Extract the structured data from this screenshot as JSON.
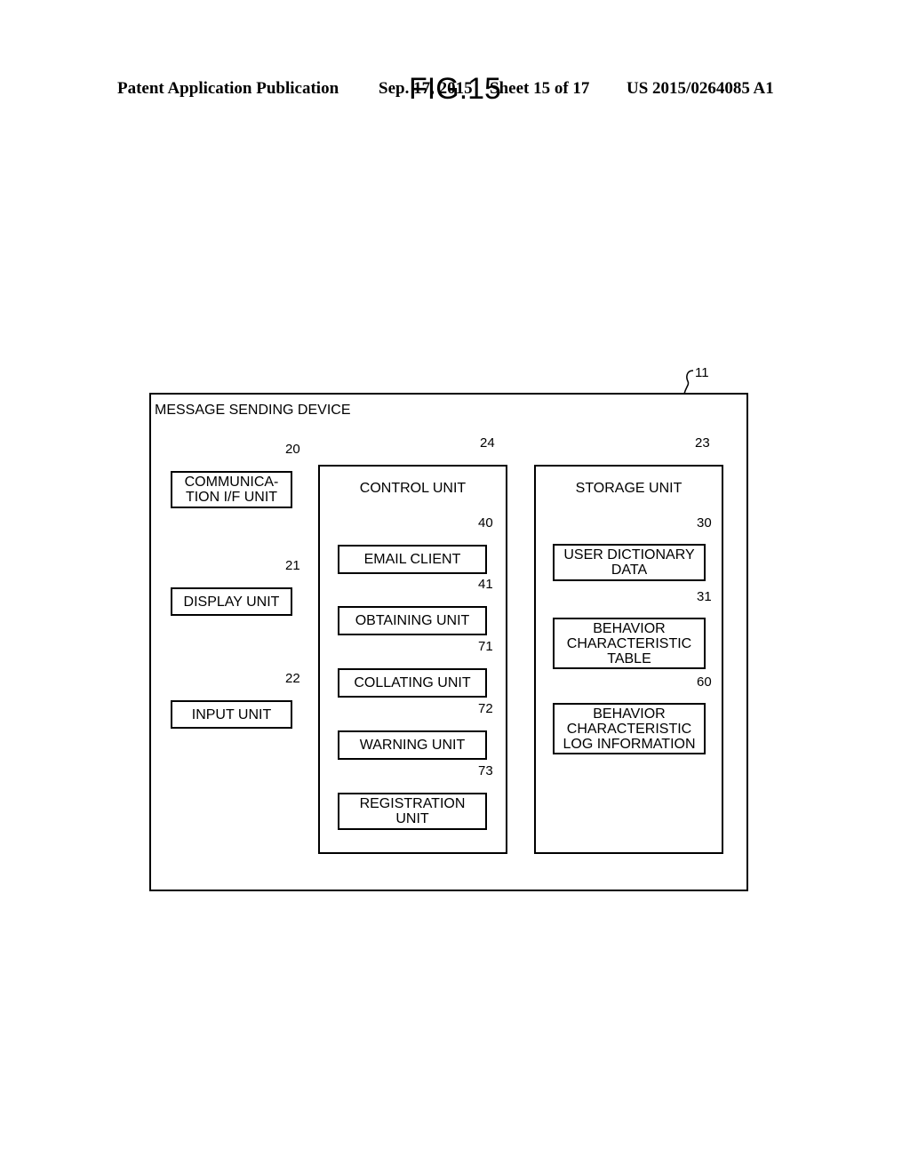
{
  "header": {
    "publication": "Patent Application Publication",
    "date": "Sep. 17, 2015",
    "sheet": "Sheet 15 of 17",
    "number": "US 2015/0264085 A1"
  },
  "figure": {
    "title": "FIG.15",
    "device": {
      "ref": "11",
      "label": "MESSAGE SENDING DEVICE"
    },
    "left_units": [
      {
        "ref": "20",
        "label": "COMMUNICA-\nTION I/F UNIT"
      },
      {
        "ref": "21",
        "label": "DISPLAY UNIT"
      },
      {
        "ref": "22",
        "label": "INPUT UNIT"
      }
    ],
    "control": {
      "ref": "24",
      "label": "CONTROL UNIT",
      "units": [
        {
          "ref": "40",
          "label": "EMAIL CLIENT"
        },
        {
          "ref": "41",
          "label": "OBTAINING UNIT"
        },
        {
          "ref": "71",
          "label": "COLLATING UNIT"
        },
        {
          "ref": "72",
          "label": "WARNING UNIT"
        },
        {
          "ref": "73",
          "label": "REGISTRATION\nUNIT"
        }
      ]
    },
    "storage": {
      "ref": "23",
      "label": "STORAGE UNIT",
      "units": [
        {
          "ref": "30",
          "label": "USER DICTIONARY\nDATA"
        },
        {
          "ref": "31",
          "label": "BEHAVIOR\nCHARACTERISTIC\nTABLE"
        },
        {
          "ref": "60",
          "label": "BEHAVIOR\nCHARACTERISTIC\nLOG INFORMATION"
        }
      ]
    }
  }
}
